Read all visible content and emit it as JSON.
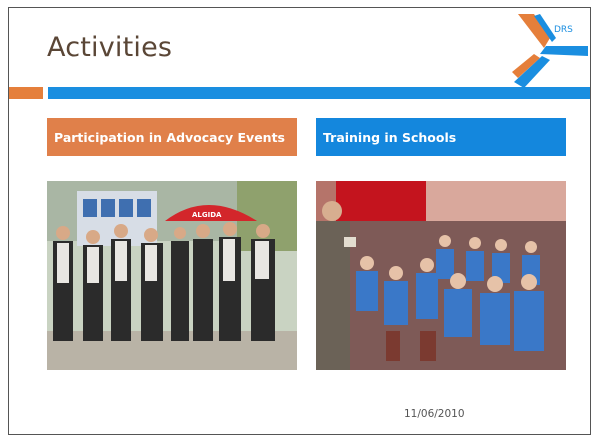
{
  "slide": {
    "title": "Activities",
    "logo_text": "DRS",
    "date": "11/06/2010"
  },
  "sections": [
    {
      "heading": "Participation in Advocacy Events",
      "color": "#e0804a",
      "photo_banner": "ALGIDA"
    },
    {
      "heading": "Training in Schools",
      "color": "#1487dd"
    }
  ],
  "colors": {
    "orange_accent": "#e57f3b",
    "blue_accent": "#1a8ee0",
    "title_color": "#5a4636"
  }
}
